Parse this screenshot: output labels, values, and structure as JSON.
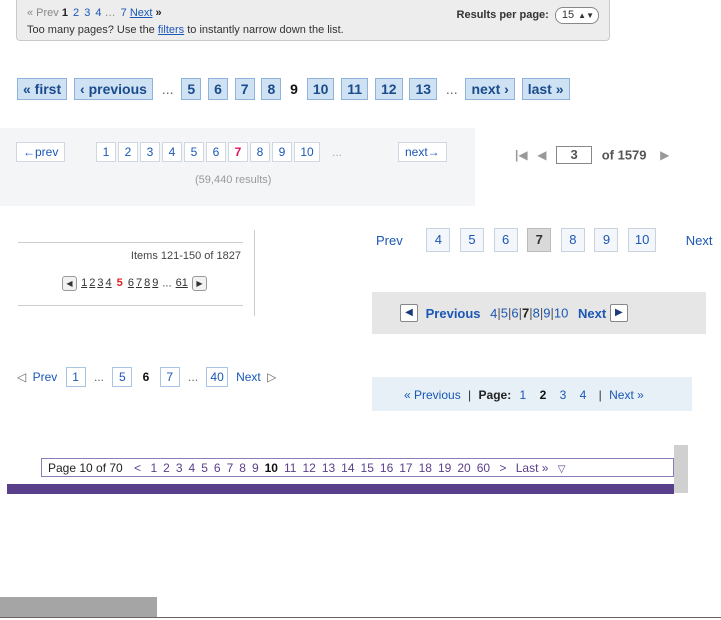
{
  "w1": {
    "prev": "« Prev",
    "current": "1",
    "pages": [
      "2",
      "3",
      "4"
    ],
    "ellipsis": "…",
    "last": "7",
    "next": "Next",
    "next_arrow": "»",
    "hint_prefix": "Too many pages? Use the",
    "hint_link": "filters",
    "hint_suffix": "to instantly narrow down the list.",
    "results_label": "Results per page:",
    "results_value": "15"
  },
  "w2": {
    "first": "« first",
    "previous": "‹ previous",
    "ellipsis": "...",
    "pages_before": [
      "5",
      "6",
      "7",
      "8"
    ],
    "current": "9",
    "pages_after": [
      "10",
      "11",
      "12",
      "13"
    ],
    "next": "next ›",
    "last": "last »"
  },
  "w3": {
    "prev": "←prev",
    "pages": [
      "1",
      "2",
      "3",
      "4",
      "5",
      "6",
      "7",
      "8",
      "9",
      "10"
    ],
    "current": "7",
    "ellipsis": "...",
    "next": "next→",
    "results": "(59,440 results)"
  },
  "w4": {
    "first_icon": "|◀",
    "prev_icon": "◀",
    "page_value": "3",
    "of_label": "of 1579",
    "next_icon": "▶"
  },
  "w5": {
    "items_label": "Items 121-150 of 1827",
    "pages": [
      "1",
      "2",
      "3",
      "4",
      "5",
      "6",
      "7",
      "8",
      "9"
    ],
    "current": "5",
    "ellipsis": "...",
    "last": "61"
  },
  "w6": {
    "prev": "Prev",
    "pages": [
      "4",
      "5",
      "6",
      "7",
      "8",
      "9",
      "10"
    ],
    "current": "7",
    "next": "Next"
  },
  "w7": {
    "previous": "Previous",
    "pages": [
      "4",
      "5",
      "6",
      "7",
      "8",
      "9",
      "10"
    ],
    "current": "7",
    "next": "Next"
  },
  "w8": {
    "prev": "Prev",
    "first": "1",
    "ellipsis": "...",
    "before": "5",
    "current": "6",
    "after": "7",
    "last": "40",
    "next": "Next"
  },
  "w9": {
    "previous": "« Previous",
    "separator": "|",
    "page_label": "Page:",
    "pages": [
      "1",
      "2",
      "3",
      "4"
    ],
    "current": "2",
    "next": "Next »"
  },
  "w10": {
    "label": "Page 10 of 70",
    "prev": "<",
    "pages": [
      "1",
      "2",
      "3",
      "4",
      "5",
      "6",
      "7",
      "8",
      "9",
      "10",
      "11",
      "12",
      "13",
      "14",
      "15",
      "16",
      "17",
      "18",
      "19",
      "20",
      "60"
    ],
    "current": "10",
    "next": ">",
    "last": "Last »",
    "menu_icon": "▽"
  },
  "colors": {
    "link_blue": "#1a57b6",
    "highlight_pink": "#e0115f",
    "highlight_red": "#e02020",
    "purple": "#5a3f8a"
  }
}
